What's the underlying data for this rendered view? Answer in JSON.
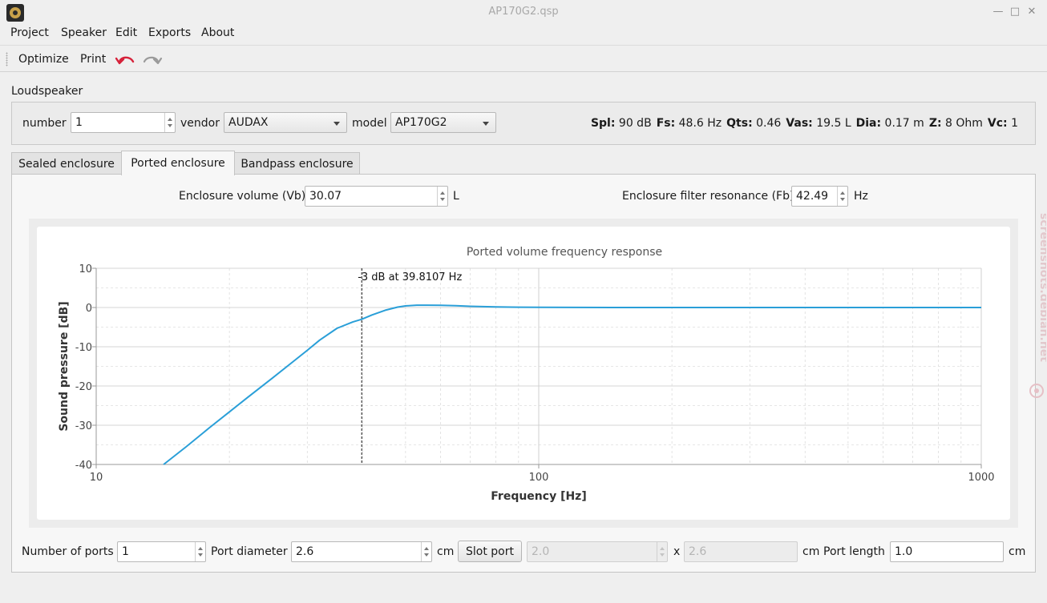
{
  "window": {
    "title": "AP170G2.qsp",
    "minimize": "—",
    "maximize": "□",
    "close": "✕"
  },
  "menu": [
    "Project",
    "Speaker",
    "Edit",
    "Exports",
    "About"
  ],
  "toolbar": {
    "optimize": "Optimize",
    "print": "Print",
    "undo_icon": "undo-arrow",
    "redo_icon": "redo-arrow"
  },
  "loudspeaker": {
    "title": "Loudspeaker",
    "number_label": "number",
    "number_value": "1",
    "vendor_label": "vendor",
    "vendor_value": "AUDAX",
    "model_label": "model",
    "model_value": "AP170G2",
    "specs": [
      {
        "name": "Spl:",
        "value": "90",
        "unit": "dB"
      },
      {
        "name": "Fs:",
        "value": "48.6",
        "unit": "Hz"
      },
      {
        "name": "Qts:",
        "value": "0.46",
        "unit": ""
      },
      {
        "name": "Vas:",
        "value": "19.5",
        "unit": "L"
      },
      {
        "name": "Dia:",
        "value": "0.17",
        "unit": "m"
      },
      {
        "name": "Z:",
        "value": "8",
        "unit": "Ohm"
      },
      {
        "name": "Vc:",
        "value": "1",
        "unit": ""
      }
    ]
  },
  "tabs": [
    "Sealed enclosure",
    "Ported enclosure",
    "Bandpass enclosure"
  ],
  "active_tab": 1,
  "ported": {
    "volume_label": "Enclosure volume (Vb)",
    "volume_value": "30.07",
    "volume_unit": "L",
    "fb_label": "Enclosure filter resonance (Fb)",
    "fb_value": "42.49",
    "fb_unit": "Hz",
    "ports_label": "Number of ports",
    "ports_value": "1",
    "diameter_label": "Port diameter",
    "diameter_value": "2.6",
    "diameter_unit": "cm",
    "slot_button": "Slot port",
    "slot_w_value": "2.0",
    "slot_x": "x",
    "slot_h_value": "2.6",
    "slot_unit": "cm",
    "length_label": "Port length",
    "length_value": "1.0",
    "length_unit": "cm"
  },
  "chart_data": {
    "type": "line",
    "title": "Ported volume frequency response",
    "xlabel": "Frequency [Hz]",
    "ylabel": "Sound pressure [dB]",
    "x_scale": "log",
    "xlim": [
      10,
      1000
    ],
    "ylim": [
      -40,
      10
    ],
    "x_ticks": [
      "10",
      "100",
      "1000"
    ],
    "y_ticks": [
      "10",
      "0",
      "-10",
      "-20",
      "-30",
      "-40"
    ],
    "grid": true,
    "series_color": "#2a9fd8",
    "annotation": {
      "text": "-3 dB at 39.8107 Hz",
      "x": 39.8107
    },
    "series": [
      {
        "x": [
          14.2,
          16,
          18,
          20,
          22,
          25,
          28,
          30,
          32,
          35,
          38,
          39.81,
          42,
          45,
          48,
          50,
          53,
          56,
          60,
          65,
          70,
          80,
          90,
          100,
          120,
          150,
          200,
          300,
          500,
          700,
          1000
        ],
        "y": [
          -40,
          -35.4,
          -30.7,
          -26.6,
          -22.9,
          -18.0,
          -13.6,
          -10.9,
          -8.3,
          -5.3,
          -3.7,
          -3.0,
          -1.9,
          -0.7,
          0.1,
          0.4,
          0.6,
          0.6,
          0.55,
          0.45,
          0.3,
          0.15,
          0.08,
          0.05,
          0.02,
          0.0,
          0.0,
          0.0,
          0.0,
          0.0,
          0.0
        ]
      }
    ]
  },
  "watermark": "screenshots.debian.net"
}
